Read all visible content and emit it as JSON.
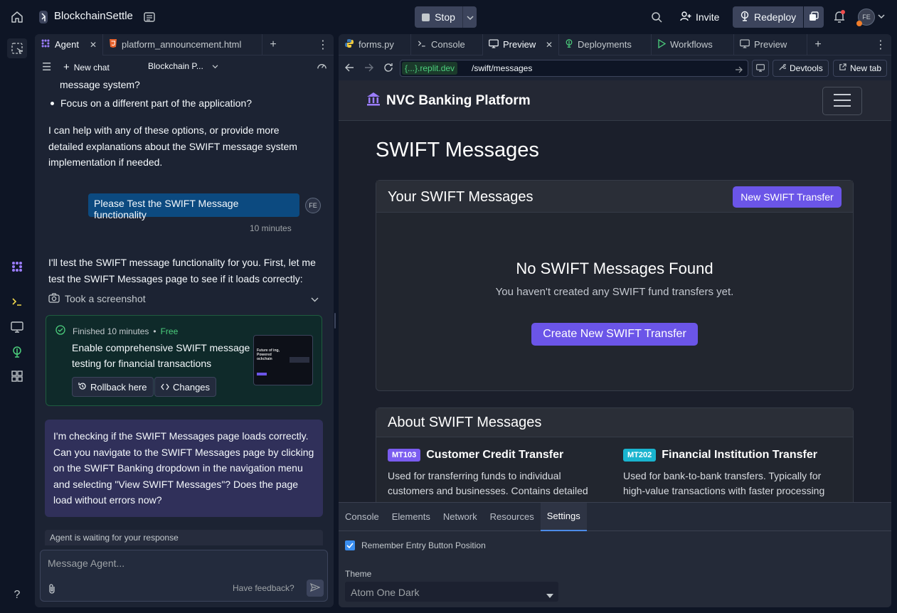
{
  "topbar": {
    "project_name": "BlockchainSettle",
    "stop_label": "Stop",
    "invite_label": "Invite",
    "redeploy_label": "Redeploy",
    "user_initials": "FE"
  },
  "agent_panel": {
    "tabs": [
      {
        "label": "Agent"
      },
      {
        "label": "platform_announcement.html"
      }
    ],
    "toolbar": {
      "new_chat_label": "New chat",
      "chat_title": "Blockchain P..."
    },
    "messages": {
      "cut_line": "message system?",
      "bullet": "Focus on a different part of the application?",
      "paragraph": "I can help with any of these options, or provide more detailed explanations about the SWIFT message system implementation if needed.",
      "user_message": "Please Test the SWIFT Message functionality",
      "user_initials": "FE",
      "user_time": "10 minutes",
      "agent_intro": "I'll test the SWIFT message functionality for you. First, let me test the SWIFT Messages page to see if it loads correctly:",
      "screenshot_label": "Took a screenshot",
      "checkpoint": {
        "status": "Finished 10 minutes",
        "dot": "•",
        "price": "Free",
        "title": "Enable comprehensive SWIFT message testing for financial transactions",
        "rollback_label": "Rollback here",
        "changes_label": "Changes",
        "thumb_text": "Future of ing, Powered ockchain"
      },
      "agent_question": "I'm checking if the SWIFT Messages page loads correctly. Can you navigate to the SWIFT Messages page by clicking on the SWIFT Banking dropdown in the navigation menu and selecting \"View SWIFT Messages\"? Does the page load without errors now?",
      "waiting": "Agent is waiting for your response"
    },
    "input": {
      "placeholder": "Message Agent...",
      "feedback_label": "Have feedback?"
    }
  },
  "right_panel": {
    "tabs": [
      {
        "label": "forms.py"
      },
      {
        "label": "Console"
      },
      {
        "label": "Preview"
      },
      {
        "label": "Deployments"
      },
      {
        "label": "Workflows"
      },
      {
        "label": "Preview"
      }
    ],
    "browser": {
      "domain": "{...}.replit.dev",
      "path": "/swift/messages",
      "devtools_label": "Devtools",
      "new_tab_label": "New tab"
    },
    "site": {
      "brand": "NVC Banking Platform",
      "page_title": "SWIFT Messages",
      "messages_card": {
        "title": "Your SWIFT Messages",
        "new_button": "New SWIFT Transfer",
        "empty_title": "No SWIFT Messages Found",
        "empty_text": "You haven't created any SWIFT fund transfers yet.",
        "create_button": "Create New SWIFT Transfer"
      },
      "about_card": {
        "title": "About SWIFT Messages",
        "items": [
          {
            "badge": "MT103",
            "badge_color": "#7a5cf0",
            "title": "Customer Credit Transfer",
            "text": "Used for transferring funds to individual customers and businesses. Contains detailed"
          },
          {
            "badge": "MT202",
            "badge_color": "#19b4cf",
            "title": "Financial Institution Transfer",
            "text": "Used for bank-to-bank transfers. Typically for high-value transactions with faster processing"
          }
        ]
      }
    },
    "devtools": {
      "tabs": [
        "Console",
        "Elements",
        "Network",
        "Resources",
        "Settings"
      ],
      "active_tab": "Settings",
      "remember_label": "Remember Entry Button Position",
      "theme_label": "Theme",
      "theme_value": "Atom One Dark"
    }
  },
  "colors": {
    "accent_purple": "#6b55e8",
    "user_bubble": "#0c4a80",
    "free_green": "#4ccf7d"
  }
}
